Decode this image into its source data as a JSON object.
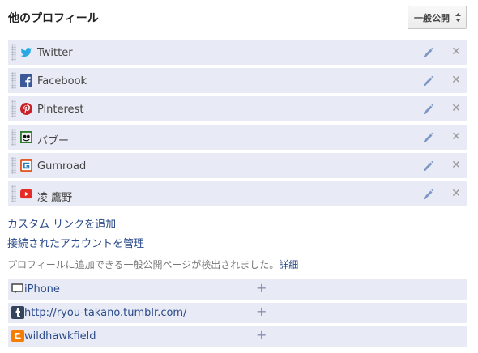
{
  "header": {
    "title": "他のプロフィール",
    "visibility_label": "一般公開"
  },
  "profiles": [
    {
      "label": "Twitter",
      "icon": "twitter-icon",
      "color": "#2aa9e0"
    },
    {
      "label": "Facebook",
      "icon": "facebook-icon",
      "color": "#3b5998"
    },
    {
      "label": "Pinterest",
      "icon": "pinterest-icon",
      "color": "#cb2027"
    },
    {
      "label": "バブー",
      "icon": "puboo-icon",
      "color": "#2e7d32"
    },
    {
      "label": "Gumroad",
      "icon": "gumroad-icon",
      "color": "#e05a2b"
    },
    {
      "label": "凌 鷹野",
      "icon": "youtube-icon",
      "color": "#e52d27"
    }
  ],
  "links": {
    "add_custom": "カスタム リンクを追加",
    "manage_accounts": "接続されたアカウントを管理"
  },
  "note": {
    "text": "プロフィールに追加できる一般公開ページが検出されました。",
    "details": "詳細"
  },
  "suggestions": [
    {
      "label": "iPhone",
      "icon": "comment-icon"
    },
    {
      "label": "http://ryou-takano.tumblr.com/",
      "icon": "tumblr-icon"
    },
    {
      "label": "wildhawkfield",
      "icon": "blogger-icon"
    }
  ]
}
